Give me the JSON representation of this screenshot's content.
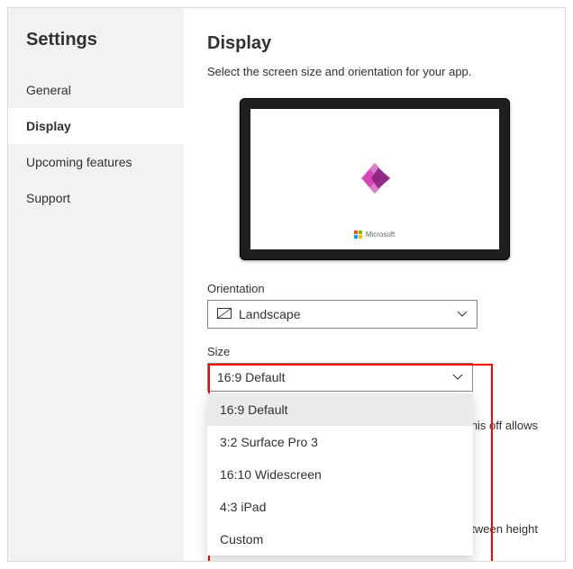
{
  "sidebar": {
    "title": "Settings",
    "items": [
      {
        "label": "General"
      },
      {
        "label": "Display"
      },
      {
        "label": "Upcoming features"
      },
      {
        "label": "Support"
      }
    ],
    "activeIndex": 1
  },
  "main": {
    "title": "Display",
    "description": "Select the screen size and orientation for your app.",
    "brand": "Microsoft",
    "orientation": {
      "label": "Orientation",
      "value": "Landscape"
    },
    "size": {
      "label": "Size",
      "value": "16:9 Default",
      "options": [
        "16:9 Default",
        "3:2 Surface Pro 3",
        "16:10 Widescreen",
        "4:3 iPad",
        "Custom"
      ],
      "selectedIndex": 0
    },
    "behindTextRight": "his off allows",
    "behindTextBottom": "between height"
  }
}
